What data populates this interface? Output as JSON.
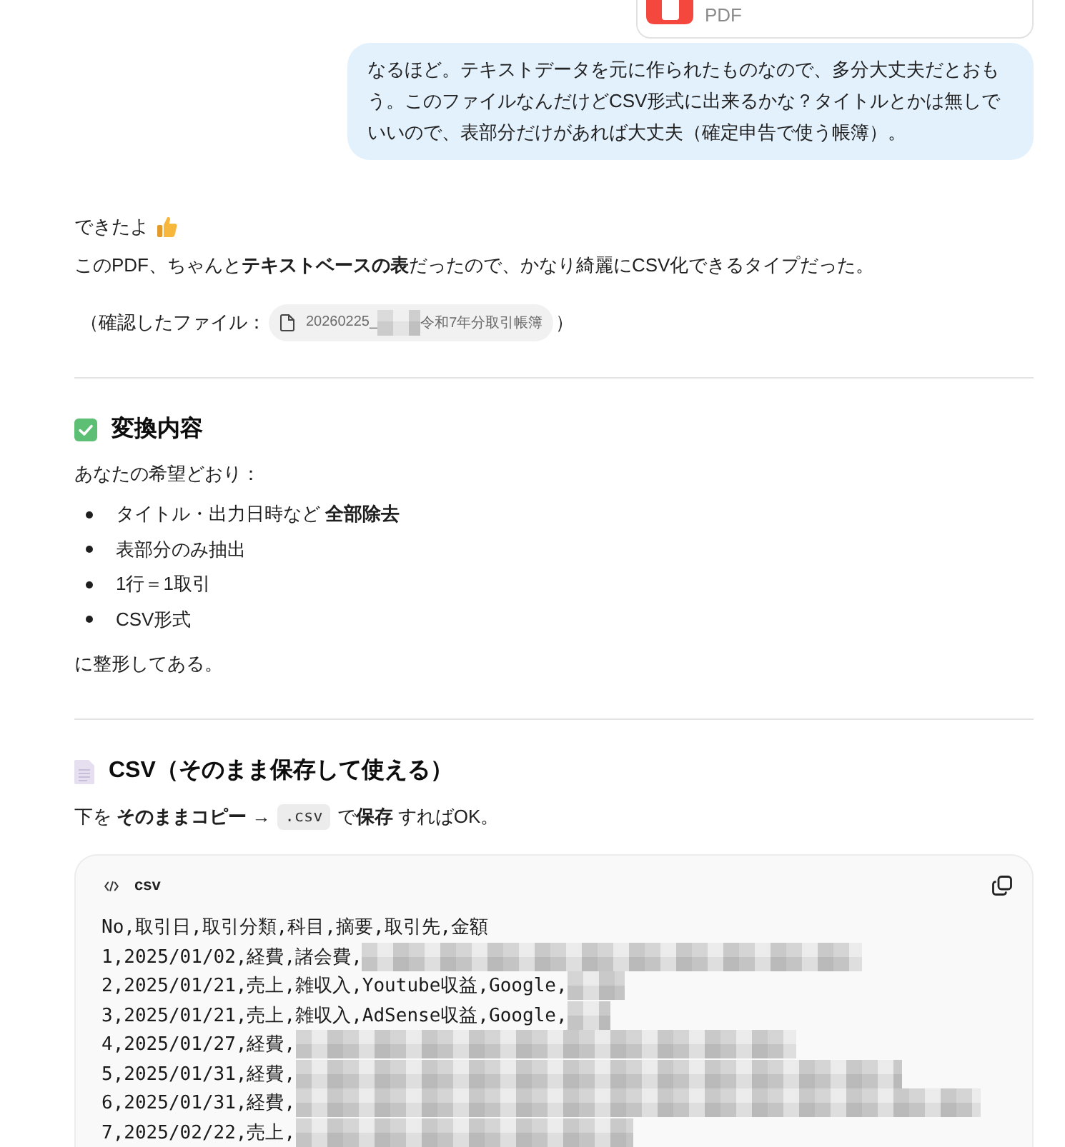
{
  "attachment": {
    "file_type": "PDF"
  },
  "user_message": {
    "text": "なるほど。テキストデータを元に作られたものなので、多分大丈夫だとおもう。このファイルなんだけどCSV形式に出来るかな？タイトルとかは無しでいいので、表部分だけがあれば大丈夫（確定申告で使う帳簿）。"
  },
  "reply": {
    "greeting": "できたよ",
    "intro": "このPDF、ちゃんと**テキストベースの表**だったので、かなり綺麗にCSV化できるタイプだった。",
    "file_note": {
      "prefix": "（確認したファイル：",
      "file_chip": {
        "kind": "tiny",
        "name_start": "20260225_",
        "name_end": "令和7年分取引帳簿"
      },
      "suffix": "）"
    },
    "conversion": {
      "heading": "変換内容",
      "lead": "あなたの希望どおり：",
      "bullets": [
        "タイトル・出力日時など **全部除去**",
        "表部分のみ抽出",
        "1行＝1取引",
        "CSV形式"
      ],
      "closing": "に整形してある。"
    },
    "csv_section": {
      "heading": "CSV（そのまま保存して使える）",
      "instruction": {
        "before": "下を **そのままコピー** →",
        "code": ".csv",
        "after": "で**保存** すればOK。"
      },
      "code_block": {
        "language": "csv",
        "lines": [
          {
            "kind": "plain",
            "text": "No,取引日,取引分類,科目,摘要,取引先,金額"
          },
          {
            "kind": "long",
            "text": "1,2025/01/02,経費,諸会費,"
          },
          {
            "kind": "short",
            "text": "2,2025/01/21,売上,雑収入,Youtube収益,Google,"
          },
          {
            "kind": "tiny",
            "text": "3,2025/01/21,売上,雑収入,AdSense収益,Google,"
          },
          {
            "kind": "long",
            "text": "4,2025/01/27,経費,"
          },
          {
            "kind": "longer",
            "text": "5,2025/01/31,経費,"
          },
          {
            "kind": "longest",
            "text": "6,2025/01/31,経費,"
          },
          {
            "kind": "medium",
            "text": "7,2025/02/22,売上,"
          }
        ]
      }
    }
  }
}
